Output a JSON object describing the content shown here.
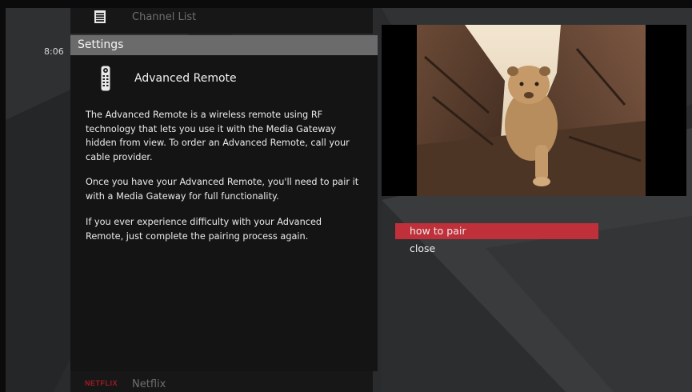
{
  "clock": "8:06",
  "channel_list": {
    "label": "Channel List",
    "icon": "list-icon"
  },
  "settings": {
    "header": "Settings",
    "title": "Advanced Remote",
    "icon": "remote-icon",
    "paragraphs": [
      "The Advanced Remote is a wireless remote using RF technology that lets you use it with the Media Gateway hidden from view. To order an Advanced Remote, call your cable provider.",
      "Once you have your Advanced Remote, you'll need to pair it with a Media Gateway for full functionality.",
      "If you ever experience difficulty with your Advanced Remote, just complete the pairing process again."
    ]
  },
  "netflix": {
    "logo": "NETFLIX",
    "label": "Netflix"
  },
  "preview": {
    "description_icon": "lion-cub-video-preview"
  },
  "actions": [
    {
      "label": "how to pair",
      "selected": true
    },
    {
      "label": "close",
      "selected": false
    }
  ],
  "colors": {
    "highlight": "#c0303b",
    "header": "#6b6b6c",
    "panel": "#141414",
    "netflix": "#9e1c23"
  }
}
